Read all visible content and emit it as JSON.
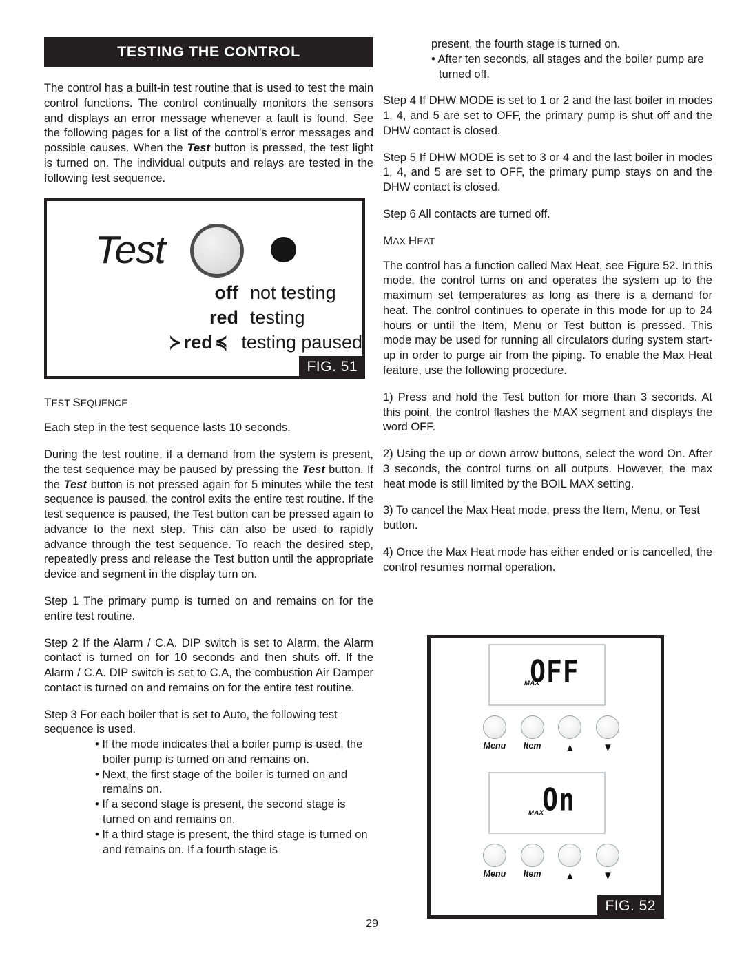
{
  "page": {
    "number": "29",
    "section_title": "TESTING THE CONTROL"
  },
  "left_column": {
    "intro_paragraph": "The control has a built-in test routine that is used to test the main control functions.  The control continually monitors the sensors and displays an error message whenever a fault is found.  See the following pages for a list of the control’s error messages and possible causes.  When the ",
    "intro_bold_1": "Test",
    "intro_paragraph_2": " button is pressed, the test light is turned on.  The individual outputs and relays are tested in the following test sequence.",
    "test_sequence_heading_cap": "T",
    "test_sequence_heading_rest": "EST ",
    "test_sequence_heading_cap2": "S",
    "test_sequence_heading_rest2": "EQUENCE",
    "each_step": "Each step in the test sequence lasts 10 seconds.",
    "during_part1": "During the test routine, if a demand from the system is present, the test sequence may be paused by pressing the ",
    "during_bold1": "Test",
    "during_part2": " button.  If the ",
    "during_bold2": "Test",
    "during_part3": " button is not pressed again for 5 minutes while the test sequence is paused, the control exits the entire test routine.  If the test sequence is paused, the Test button can be pressed again to advance to the next step. This can also be used to rapidly advance through the test sequence. To reach the desired step, repeatedly press and release the Test button until the appropriate device and segment in the display turn on.",
    "step1": "Step 1   The primary pump is turned on and remains on for the entire test routine.",
    "step2": "Step 2   If the Alarm / C.A. DIP switch is set to Alarm, the Alarm contact is turned on for 10 seconds and then shuts off.  If the Alarm / C.A. DIP switch is set to C.A, the combustion Air Damper contact is turned on and remains on for the entire test routine.",
    "step3": "Step 3 For each boiler that is set to Auto, the following test sequence is used.",
    "step3_bullets": [
      "• If the mode indicates that a boiler pump is used, the boiler pump is turned on and remains on.",
      "• Next, the first stage of the boiler is turned on and remains on.",
      "• If a second stage is present, the second stage is turned on and remains on.",
      "• If a third stage is present, the third stage is turned on and remains on. If a fourth stage is"
    ]
  },
  "right_column": {
    "cont_bullets": [
      "present, the fourth stage is turned on.",
      "• After ten seconds, all stages and the boiler pump are turned off."
    ],
    "step4": "Step 4  If DHW MODE is set to 1 or 2 and the last boiler in modes 1, 4, and 5 are set to OFF, the primary pump is shut off and the DHW contact is closed.",
    "step5": "Step 5  If DHW MODE is set to 3 or 4 and the last boiler in modes 1, 4, and 5 are set to OFF, the primary pump stays on and the DHW contact is closed.",
    "step6": "Step 6 All contacts are turned off.",
    "max_heat_heading_cap": "M",
    "max_heat_heading_rest": "AX ",
    "max_heat_heading_cap2": "H",
    "max_heat_heading_rest2": "EAT",
    "max_heat_paragraph": "The control has a function called Max Heat, see Figure 52.  In this mode, the control turns on and operates the system up to the maximum set temperatures as long as there is a demand for heat.  The control continues to operate in this mode for up to 24 hours or until the Item, Menu or Test button is pressed.  This mode may be used for running all circulators during system start-up in order to purge air from the piping.  To enable the Max Heat feature, use the following procedure.",
    "proc1": "1) Press and hold the Test button for more than 3 seconds. At this point, the control flashes the MAX segment and displays the word OFF.",
    "proc2": "2) Using the up or down arrow buttons, select the word On. After 3 seconds, the control turns on all outputs. However, the max heat mode is still limited by the BOIL MAX setting.",
    "proc3": "3) To cancel the Max Heat mode, press the Item, Menu, or Test button.",
    "proc4": "4) Once the Max Heat mode has either ended or is cancelled, the control resumes normal operation."
  },
  "figure51": {
    "badge": "FIG.  51",
    "button_word": "Test",
    "legend": [
      {
        "state": "off",
        "description": "not testing"
      },
      {
        "state": "red",
        "description": "testing"
      },
      {
        "state": "red",
        "description": "testing paused",
        "flashing": true
      }
    ],
    "flash_left": "≻",
    "flash_right": "≼"
  },
  "figure52": {
    "badge": "FIG.  52",
    "displays": [
      {
        "value": "OFF",
        "tag": "MAX"
      },
      {
        "value": "On",
        "tag": "MAX"
      }
    ],
    "buttons": [
      {
        "label": "Menu",
        "kind": "text"
      },
      {
        "label": "Item",
        "kind": "text"
      },
      {
        "label": "▲",
        "kind": "arrow"
      },
      {
        "label": "▼",
        "kind": "arrow"
      }
    ]
  },
  "colors": {
    "ink": "#231f20",
    "banner_bg": "#231f20",
    "banner_text": "#ffffff",
    "lcd_border": "#c9ccd1"
  }
}
